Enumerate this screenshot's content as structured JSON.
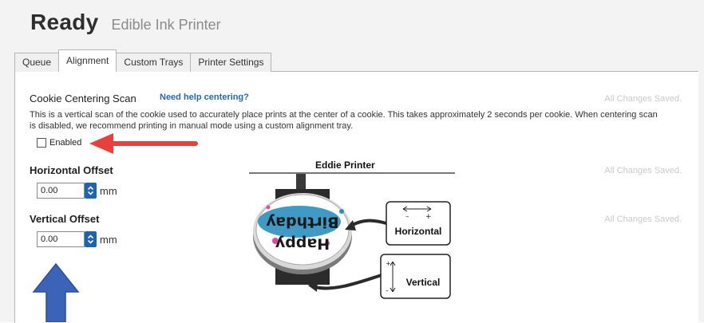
{
  "header": {
    "title": "Ready",
    "subtitle": "Edible Ink Printer"
  },
  "tabs": [
    {
      "label": "Queue",
      "active": false
    },
    {
      "label": "Alignment",
      "active": true
    },
    {
      "label": "Custom Trays",
      "active": false
    },
    {
      "label": "Printer Settings",
      "active": false
    }
  ],
  "scan": {
    "title": "Cookie Centering Scan",
    "help_link": "Need help centering?",
    "saved_status": "All Changes Saved.",
    "description": "This is a vertical scan of the cookie used to accurately place prints at the center of a cookie. This takes approximately 2 seconds per cookie. When centering scan is disabled, we recommend printing in manual mode using a custom alignment tray.",
    "enabled_label": "Enabled",
    "enabled_checked": false
  },
  "horizontal": {
    "label": "Horizontal Offset",
    "value": "0.00",
    "unit": "mm",
    "saved_status": "All Changes Saved."
  },
  "vertical": {
    "label": "Vertical Offset",
    "value": "0.00",
    "unit": "mm",
    "saved_status": "All Changes Saved."
  },
  "diagram": {
    "title": "Eddie Printer",
    "cookie_text_line1": "Birthday",
    "cookie_text_line2": "Happy",
    "horizontal_label": "Horizontal",
    "vertical_label": "Vertical",
    "plus_symbol": "+",
    "minus_symbol": "–"
  },
  "colors": {
    "accent": "#1f63b3",
    "link": "#2367b8",
    "red_arrow": "#e8413d",
    "blue_arrow": "#3b63b8",
    "cookie_blue": "#2a8fc0"
  }
}
